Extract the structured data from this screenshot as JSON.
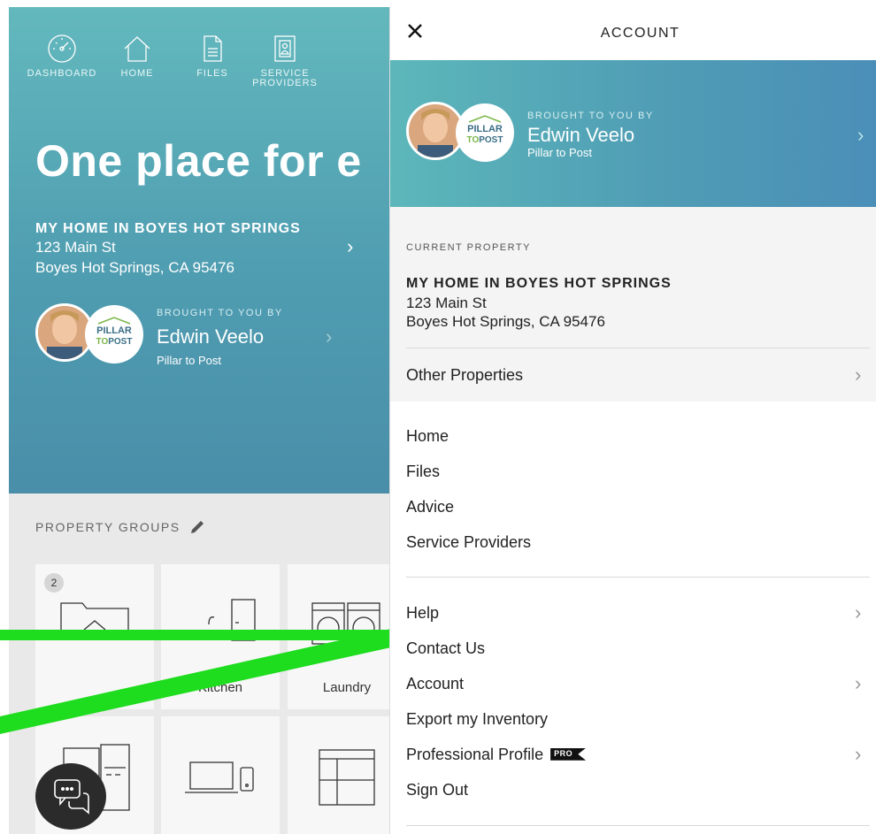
{
  "app": {
    "nav": [
      {
        "label": "DASHBOARD",
        "icon": "gauge-icon"
      },
      {
        "label": "HOME",
        "icon": "house-icon"
      },
      {
        "label": "FILES",
        "icon": "file-icon"
      },
      {
        "label": "SERVICE PROVIDERS",
        "icon": "contact-card-icon"
      }
    ],
    "headline": "One place for e",
    "home": {
      "title": "MY HOME IN BOYES HOT SPRINGS",
      "address1": "123 Main St",
      "address2": "Boyes Hot Springs, CA 95476"
    },
    "sponsor": {
      "brought": "BROUGHT TO YOU BY",
      "name": "Edwin Veelo",
      "company": "Pillar to Post",
      "logo_top": "PILLAR",
      "logo_bottom_a": "TO",
      "logo_bottom_b": "POST"
    },
    "groups_label": "PROPERTY GROUPS",
    "tiles": [
      {
        "label": "",
        "badge": "2",
        "icon": "folder-house-icon"
      },
      {
        "label": "Kitchen",
        "icon": "kitchen-icon"
      },
      {
        "label": "Laundry",
        "icon": "washer-dryer-icon"
      },
      {
        "label": "",
        "icon": "appliance-icon"
      },
      {
        "label": "",
        "icon": "laptop-phone-icon"
      },
      {
        "label": "",
        "icon": "storage-shelves-icon"
      }
    ]
  },
  "panel": {
    "title": "ACCOUNT",
    "sponsor": {
      "brought": "BROUGHT TO YOU BY",
      "name": "Edwin Veelo",
      "company": "Pillar to Post"
    },
    "current": {
      "label": "CURRENT PROPERTY",
      "title": "MY HOME IN BOYES HOT SPRINGS",
      "address1": "123 Main St",
      "address2": "Boyes Hot Springs, CA 95476"
    },
    "other_properties": "Other Properties",
    "nav_links": [
      "Home",
      "Files",
      "Advice",
      "Service Providers"
    ],
    "menu": {
      "help": "Help",
      "contact": "Contact Us",
      "account": "Account",
      "export": "Export my Inventory",
      "pro_profile": "Professional Profile",
      "pro_badge": "PRO",
      "sign_out": "Sign Out"
    }
  },
  "colors": {
    "hero_teal": "#5aa8b4",
    "annotation_green": "#1edc1e",
    "chat_button": "#2b2b2b"
  }
}
